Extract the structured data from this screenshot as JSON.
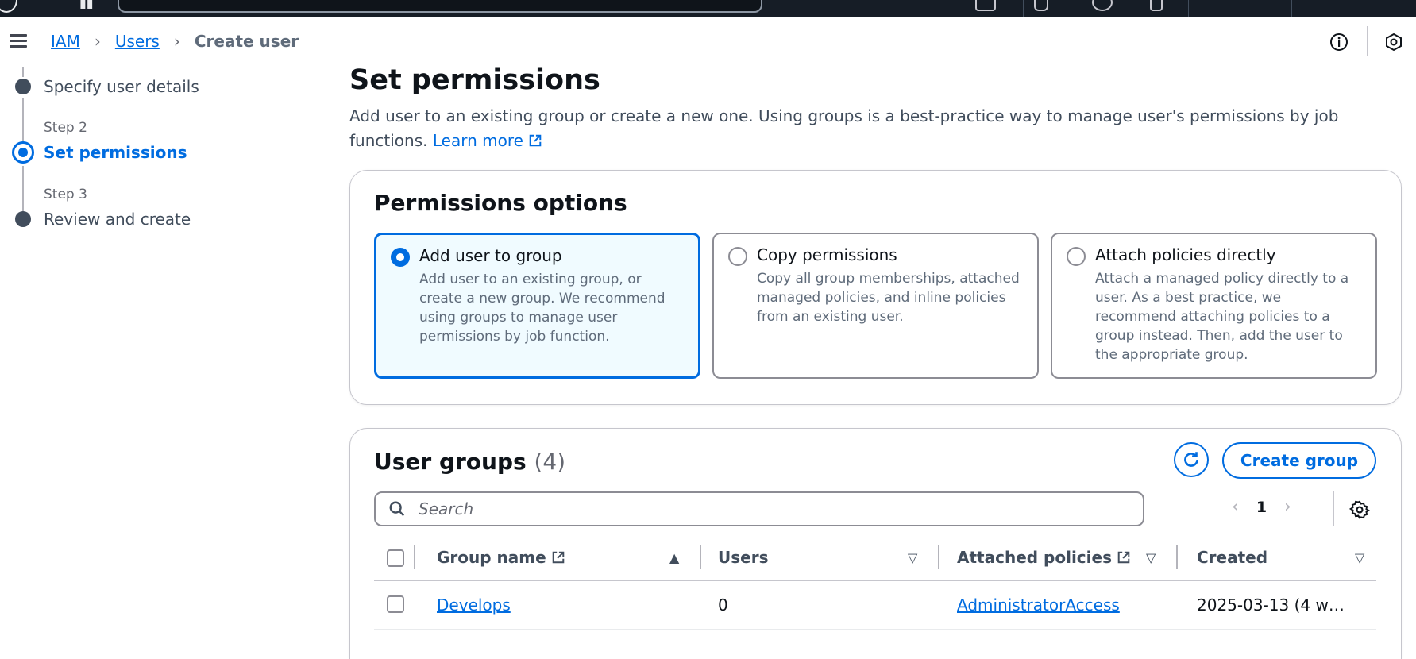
{
  "breadcrumb": {
    "root": "IAM",
    "section": "Users",
    "current": "Create user"
  },
  "steps": [
    {
      "caption": "",
      "title": "Specify user details",
      "state": "done"
    },
    {
      "caption": "Step 2",
      "title": "Set permissions",
      "state": "active"
    },
    {
      "caption": "Step 3",
      "title": "Review and create",
      "state": "pending"
    }
  ],
  "page": {
    "title": "Set permissions",
    "description": "Add user to an existing group or create a new one. Using groups is a best-practice way to manage user's permissions by job functions.",
    "learn_more": "Learn more"
  },
  "permissions_options": {
    "title": "Permissions options",
    "options": [
      {
        "label": "Add user to group",
        "description": "Add user to an existing group, or create a new group. We recommend using groups to manage user permissions by job function.",
        "selected": true
      },
      {
        "label": "Copy permissions",
        "description": "Copy all group memberships, attached managed policies, and inline policies from an existing user.",
        "selected": false
      },
      {
        "label": "Attach policies directly",
        "description": "Attach a managed policy directly to a user. As a best practice, we recommend attaching policies to a group instead. Then, add the user to the appropriate group.",
        "selected": false
      }
    ]
  },
  "user_groups": {
    "title": "User groups",
    "count": "(4)",
    "create_button": "Create group",
    "search_placeholder": "Search",
    "page_number": "1",
    "columns": {
      "group_name": "Group name",
      "users": "Users",
      "attached_policies": "Attached policies",
      "created": "Created"
    },
    "rows": [
      {
        "group_name": "Develops",
        "users": "0",
        "attached_policies": "AdministratorAccess",
        "created": "2025-03-13 (4 w…"
      }
    ]
  },
  "colors": {
    "accent": "#006ce0",
    "topbar": "#161d26",
    "selected_bg": "#f0fbff"
  }
}
